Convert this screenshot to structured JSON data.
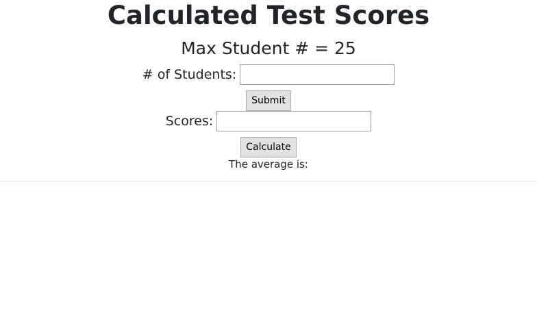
{
  "title": "Calculated Test Scores",
  "subtitle": "Max Student # = 25",
  "students_form": {
    "label": "# of Students:",
    "value": "",
    "placeholder": "",
    "submit_label": "Submit"
  },
  "scores_form": {
    "label": "Scores:",
    "value": "",
    "placeholder": "",
    "calculate_label": "Calculate"
  },
  "result": {
    "average_label": "The average is:"
  }
}
